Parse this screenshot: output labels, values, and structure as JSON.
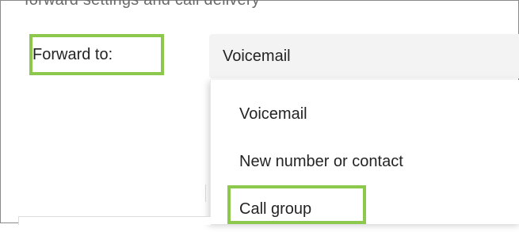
{
  "form": {
    "cut_off_text": "forward settings and call delivery",
    "forward_label": "Forward to:",
    "selected_option": "Voicemail"
  },
  "dropdown": {
    "options": [
      {
        "label": "Voicemail"
      },
      {
        "label": "New number or contact"
      },
      {
        "label": "Call group"
      }
    ]
  },
  "colors": {
    "highlight": "#8cc84b",
    "field_background": "#f3f3f3",
    "text": "#242424"
  }
}
